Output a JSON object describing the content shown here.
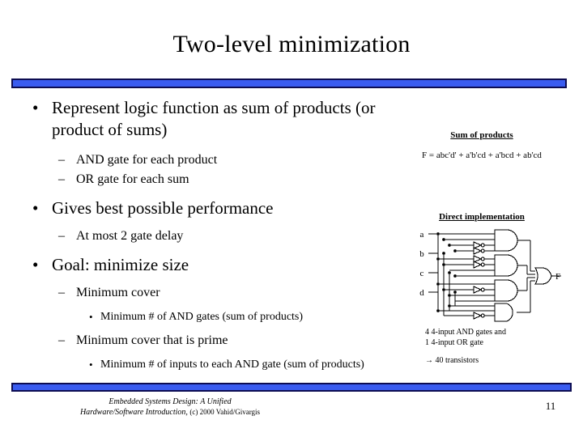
{
  "slide": {
    "title": "Two-level minimization",
    "page_number": "11",
    "accent_color": "#3a5cf0",
    "accent_border_color": "#0d0d52"
  },
  "bullets": [
    {
      "level": 1,
      "marker": "•",
      "text": "Represent logic function as sum of products (or product of sums)"
    },
    {
      "level": 2,
      "marker": "–",
      "text": "AND gate for each product"
    },
    {
      "level": 2,
      "marker": "–",
      "text": "OR gate for each sum"
    },
    {
      "level": 1,
      "marker": "•",
      "text": "Gives best possible performance"
    },
    {
      "level": 2,
      "marker": "–",
      "text": "At most 2 gate delay"
    },
    {
      "level": 1,
      "marker": "•",
      "text": "Goal: minimize size"
    },
    {
      "level": 2,
      "marker": "–",
      "text": "Minimum cover"
    },
    {
      "level": 3,
      "marker": "•",
      "text": "Minimum # of AND gates (sum of products)"
    },
    {
      "level": 2,
      "marker": "–",
      "text": "Minimum cover that is prime"
    },
    {
      "level": 3,
      "marker": "•",
      "text": "Minimum # of inputs to each AND gate (sum of products)"
    }
  ],
  "sum_of_products": {
    "heading": "Sum of products",
    "equation": "F = abc'd' + a'b'cd + a'bcd + ab'cd"
  },
  "direct_implementation": {
    "heading": "Direct implementation",
    "inputs": [
      "a",
      "b",
      "c",
      "d"
    ],
    "output": "F",
    "note_line1": "4 4-input AND gates and",
    "note_line2": "1 4-input OR gate",
    "note_line3": "→ 40 transistors"
  },
  "footer": {
    "line1": "Embedded Systems Design: A Unified",
    "line2_italic": "Hardware/Software Introduction,",
    "line2_plain": "(c) 2000 Vahid/Givargis"
  }
}
